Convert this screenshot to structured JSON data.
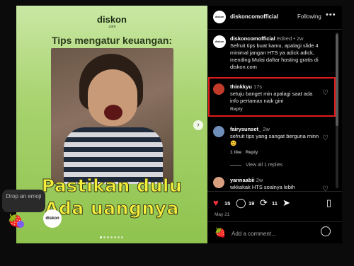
{
  "media": {
    "brand": "diskon",
    "brand_sub": ".com",
    "headline": "Tips mengatur keuangan:",
    "overlay_line1": "Pastikan dulu",
    "overlay_line2": "Ada uangnya",
    "logo_text": "diskon",
    "next_icon": "chevron-right-icon",
    "dots_count": 7
  },
  "drop_tip": "Drop an emoji",
  "header": {
    "username": "diskoncomofficial",
    "follow": "Following",
    "more": "•••",
    "avatar_text": "diskon"
  },
  "caption": {
    "username": "diskoncomofficial",
    "edited": "Edited",
    "sep": "•",
    "age": "2w",
    "text": "Sefruit tips buat kamu, apalagi slide 4 minimal jangan HTS ya adick adick, mending Mulai daftar hosting gratis di diskon.com"
  },
  "comments": [
    {
      "username": "thinkkyu",
      "age": "17s",
      "text": "setuju banget min apalagi saat ada info pertamax naik gini",
      "reply": "Reply",
      "avatar_color": "#c23a2a"
    },
    {
      "username": "fairysunset_",
      "age": "2w",
      "text": "sefruit tips yang sangat berguna minn 😊",
      "likes": "1 like",
      "reply": "Reply",
      "avatar_color": "#6f8fb8"
    },
    {
      "username": "yannaabii",
      "age": "2w",
      "text": "wkkakak HTS soalnya lebih menantang 😂",
      "avatar_color": "#d9a080"
    }
  ],
  "view_replies": "View all 1 replies",
  "actions": {
    "likes": "15",
    "comments": "19",
    "reposts": "11",
    "date": "May 21"
  },
  "add_comment": {
    "placeholder": "Add a comment…"
  },
  "colors": {
    "highlight": "#e11b1b",
    "accent_purple": "#7d5cf0",
    "like_red": "#ff3040"
  }
}
